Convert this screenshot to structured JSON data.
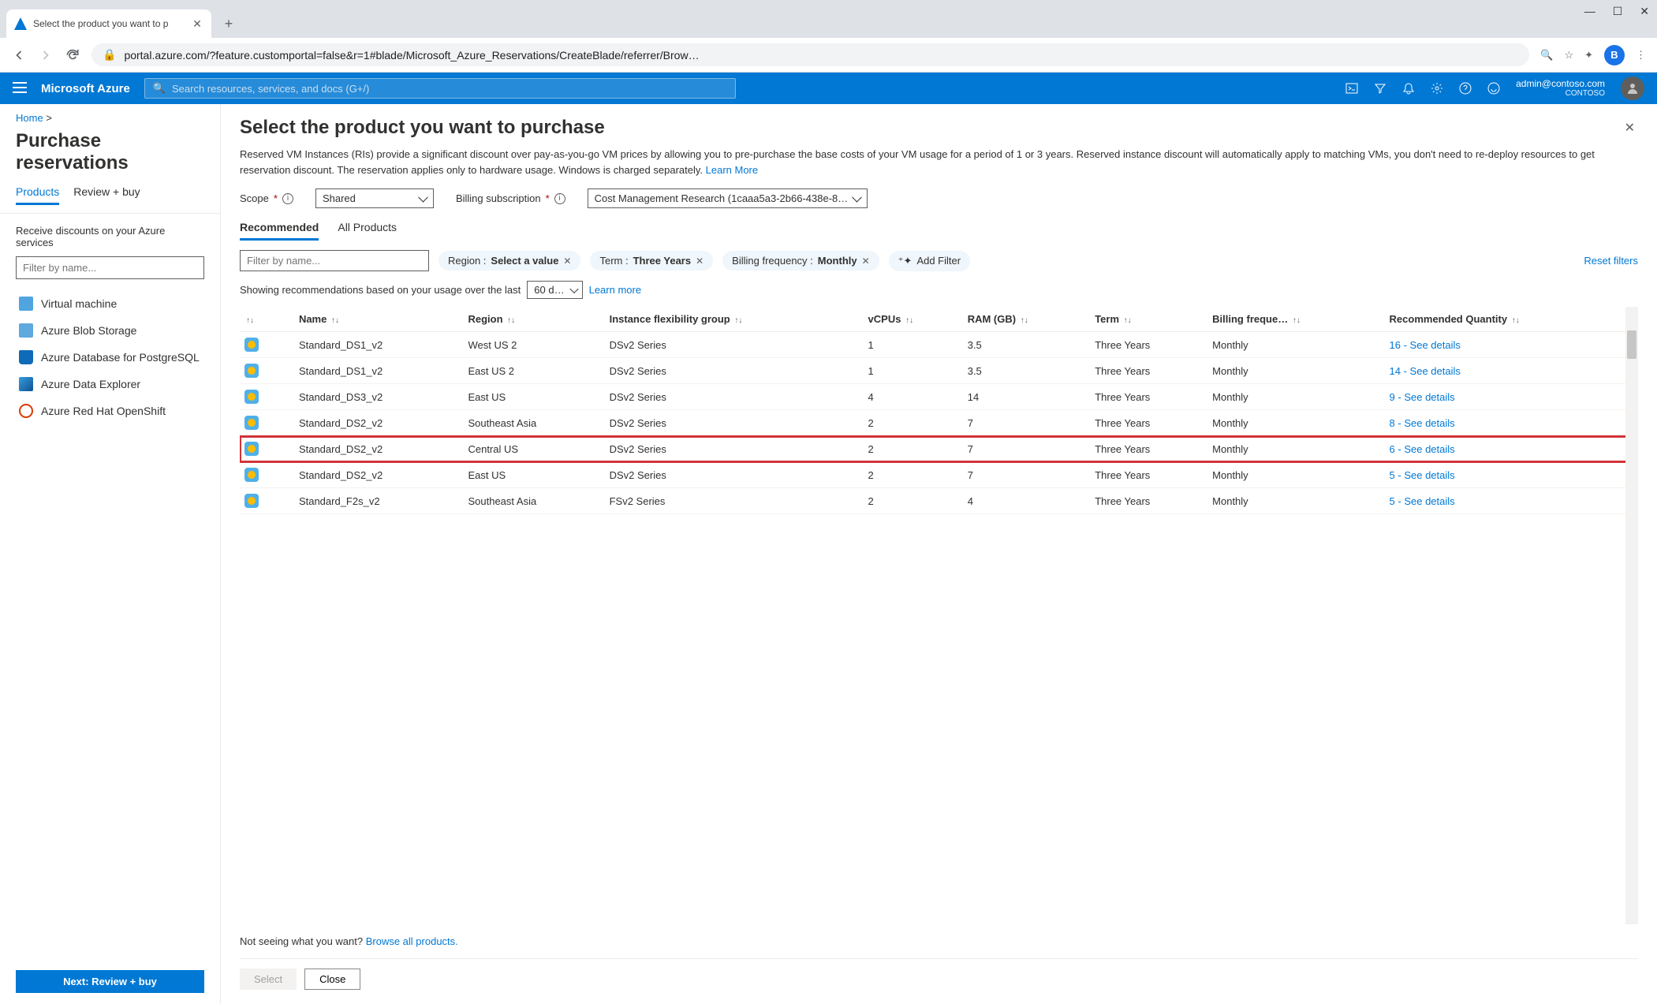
{
  "browser": {
    "tab_title": "Select the product you want to p",
    "url": "portal.azure.com/?feature.customportal=false&r=1#blade/Microsoft_Azure_Reservations/CreateBlade/referrer/Brow…",
    "avatar_letter": "B"
  },
  "azure_bar": {
    "brand": "Microsoft Azure",
    "search_placeholder": "Search resources, services, and docs (G+/)",
    "account_email": "admin@contoso.com",
    "tenant": "CONTOSO"
  },
  "left": {
    "breadcrumb_home": "Home",
    "page_title": "Purchase reservations",
    "tabs": {
      "products": "Products",
      "review": "Review + buy"
    },
    "discount_note": "Receive discounts on your Azure services",
    "filter_placeholder": "Filter by name...",
    "services": [
      {
        "label": "Virtual machine",
        "icon": "vm"
      },
      {
        "label": "Azure Blob Storage",
        "icon": "blob"
      },
      {
        "label": "Azure Database for PostgreSQL",
        "icon": "db"
      },
      {
        "label": "Azure Data Explorer",
        "icon": "dex"
      },
      {
        "label": "Azure Red Hat OpenShift",
        "icon": "openshift"
      }
    ],
    "cta": "Next: Review + buy"
  },
  "right": {
    "title": "Select the product you want to purchase",
    "desc_line": "Reserved VM Instances (RIs) provide a significant discount over pay-as-you-go VM prices by allowing you to pre-purchase the base costs of your VM usage for a period of 1 or 3 years. Reserved instance discount will automatically apply to matching VMs, you don't need to re-deploy resources to get reservation discount. The reservation applies only to hardware usage. Windows is charged separately. ",
    "learn_more": "Learn More",
    "scope_label": "Scope",
    "scope_value": "Shared",
    "billing_label": "Billing subscription",
    "billing_value": "Cost Management Research (1caaa5a3-2b66-438e-8…",
    "tabs": {
      "recommended": "Recommended",
      "all": "All Products"
    },
    "name_filter_placeholder": "Filter by name...",
    "pill_region_k": "Region : ",
    "pill_region_v": "Select a value",
    "pill_term_k": "Term : ",
    "pill_term_v": "Three Years",
    "pill_freq_k": "Billing frequency : ",
    "pill_freq_v": "Monthly",
    "add_filter": "Add Filter",
    "reset": "Reset filters",
    "usage_prefix": "Showing recommendations based on your usage over the last",
    "usage_dd": "60 d…",
    "usage_learn": "Learn more",
    "columns": {
      "name": "Name",
      "region": "Region",
      "flex": "Instance flexibility group",
      "vcpu": "vCPUs",
      "ram": "RAM (GB)",
      "term": "Term",
      "freq": "Billing freque…",
      "qty": "Recommended Quantity"
    },
    "rows": [
      {
        "name": "Standard_DS1_v2",
        "region": "West US 2",
        "flex": "DSv2 Series",
        "vcpu": "1",
        "ram": "3.5",
        "term": "Three Years",
        "freq": "Monthly",
        "qty": "16 - See details"
      },
      {
        "name": "Standard_DS1_v2",
        "region": "East US 2",
        "flex": "DSv2 Series",
        "vcpu": "1",
        "ram": "3.5",
        "term": "Three Years",
        "freq": "Monthly",
        "qty": "14 - See details"
      },
      {
        "name": "Standard_DS3_v2",
        "region": "East US",
        "flex": "DSv2 Series",
        "vcpu": "4",
        "ram": "14",
        "term": "Three Years",
        "freq": "Monthly",
        "qty": "9 - See details"
      },
      {
        "name": "Standard_DS2_v2",
        "region": "Southeast Asia",
        "flex": "DSv2 Series",
        "vcpu": "2",
        "ram": "7",
        "term": "Three Years",
        "freq": "Monthly",
        "qty": "8 - See details"
      },
      {
        "name": "Standard_DS2_v2",
        "region": "Central US",
        "flex": "DSv2 Series",
        "vcpu": "2",
        "ram": "7",
        "term": "Three Years",
        "freq": "Monthly",
        "qty": "6 - See details",
        "highlight": true
      },
      {
        "name": "Standard_DS2_v2",
        "region": "East US",
        "flex": "DSv2 Series",
        "vcpu": "2",
        "ram": "7",
        "term": "Three Years",
        "freq": "Monthly",
        "qty": "5 - See details"
      },
      {
        "name": "Standard_F2s_v2",
        "region": "Southeast Asia",
        "flex": "FSv2 Series",
        "vcpu": "2",
        "ram": "4",
        "term": "Three Years",
        "freq": "Monthly",
        "qty": "5 - See details"
      }
    ],
    "not_seeing": "Not seeing what you want? ",
    "browse_all": "Browse all products.",
    "btn_select": "Select",
    "btn_close": "Close"
  }
}
